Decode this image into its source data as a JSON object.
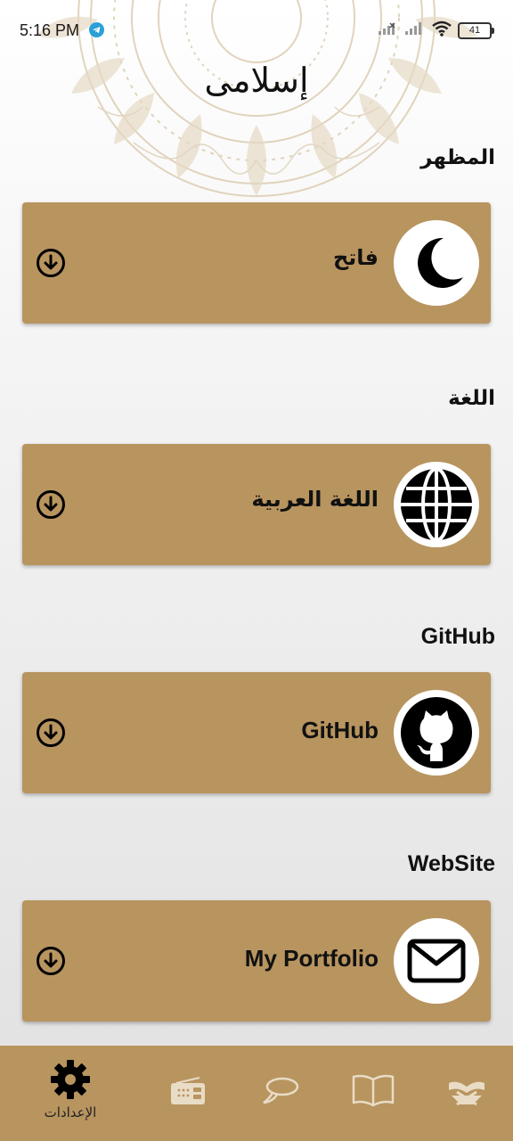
{
  "status_bar": {
    "time": "5:16 PM",
    "battery": "41",
    "icons": [
      "telegram-icon",
      "signal-x-icon",
      "signal-icon",
      "wifi-icon",
      "battery-icon"
    ]
  },
  "app_title": "إسلامى",
  "sections": [
    {
      "title": "المظهر",
      "card_label": "فاتح",
      "icon": "moon-icon"
    },
    {
      "title": "اللغة",
      "card_label": "اللغة العربية",
      "icon": "globe-icon"
    },
    {
      "title": "GitHub",
      "card_label": "GitHub",
      "icon": "github-icon"
    },
    {
      "title": "WebSite",
      "card_label": "My Portfolio",
      "icon": "mail-icon"
    }
  ],
  "bottom_nav": {
    "items": [
      {
        "name": "settings",
        "label": "الإعدادات",
        "icon": "gear-icon",
        "active": true
      },
      {
        "name": "radio",
        "icon": "radio-icon"
      },
      {
        "name": "azkar",
        "icon": "speech-bubble-icon"
      },
      {
        "name": "hadith",
        "icon": "open-book-icon"
      },
      {
        "name": "quran",
        "icon": "quran-stand-icon"
      }
    ]
  },
  "colors": {
    "card": "#b8945f",
    "nav": "#b8945f",
    "decoration": "#d8c9ad"
  }
}
